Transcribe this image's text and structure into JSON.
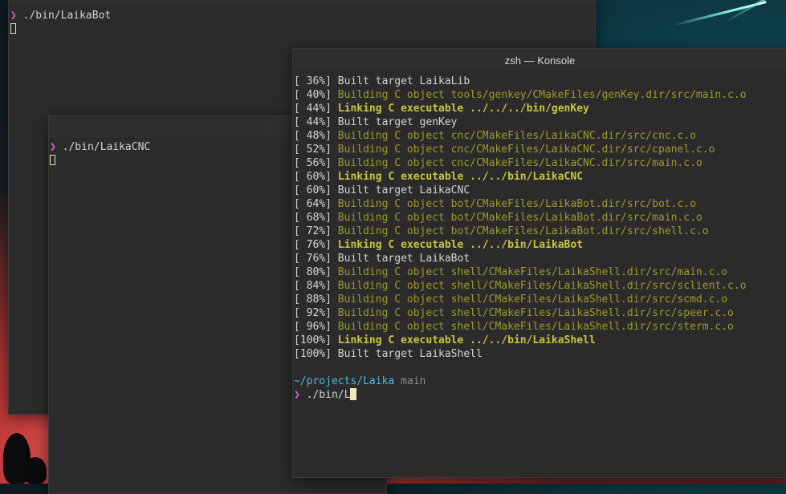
{
  "colors": {
    "terminal_bg": "#2b2b2b",
    "prompt_arrow": "#e05ec8",
    "building": "#9a9a2c",
    "linking": "#c7c73c",
    "cwd": "#4fb8e0",
    "branch": "#8a8a8a"
  },
  "windows": {
    "back": {
      "prompt_symbol": "❯",
      "command": " ./bin/LaikaBot"
    },
    "middle": {
      "prompt_symbol": "❯",
      "command": " ./bin/LaikaCNC"
    },
    "front": {
      "title": "zsh — Konsole",
      "build_output": [
        {
          "pct": "[ 36%] ",
          "text": "Built target LaikaLib",
          "kind": "built"
        },
        {
          "pct": "[ 40%] ",
          "text": "Building C object tools/genkey/CMakeFiles/genKey.dir/src/main.c.o",
          "kind": "building"
        },
        {
          "pct": "[ 44%] ",
          "text": "Linking C executable ../../../bin/genKey",
          "kind": "linking"
        },
        {
          "pct": "[ 44%] ",
          "text": "Built target genKey",
          "kind": "built"
        },
        {
          "pct": "[ 48%] ",
          "text": "Building C object cnc/CMakeFiles/LaikaCNC.dir/src/cnc.c.o",
          "kind": "building"
        },
        {
          "pct": "[ 52%] ",
          "text": "Building C object cnc/CMakeFiles/LaikaCNC.dir/src/cpanel.c.o",
          "kind": "building"
        },
        {
          "pct": "[ 56%] ",
          "text": "Building C object cnc/CMakeFiles/LaikaCNC.dir/src/main.c.o",
          "kind": "building"
        },
        {
          "pct": "[ 60%] ",
          "text": "Linking C executable ../../bin/LaikaCNC",
          "kind": "linking"
        },
        {
          "pct": "[ 60%] ",
          "text": "Built target LaikaCNC",
          "kind": "built"
        },
        {
          "pct": "[ 64%] ",
          "text": "Building C object bot/CMakeFiles/LaikaBot.dir/src/bot.c.o",
          "kind": "building"
        },
        {
          "pct": "[ 68%] ",
          "text": "Building C object bot/CMakeFiles/LaikaBot.dir/src/main.c.o",
          "kind": "building"
        },
        {
          "pct": "[ 72%] ",
          "text": "Building C object bot/CMakeFiles/LaikaBot.dir/src/shell.c.o",
          "kind": "building"
        },
        {
          "pct": "[ 76%] ",
          "text": "Linking C executable ../../bin/LaikaBot",
          "kind": "linking"
        },
        {
          "pct": "[ 76%] ",
          "text": "Built target LaikaBot",
          "kind": "built"
        },
        {
          "pct": "[ 80%] ",
          "text": "Building C object shell/CMakeFiles/LaikaShell.dir/src/main.c.o",
          "kind": "building"
        },
        {
          "pct": "[ 84%] ",
          "text": "Building C object shell/CMakeFiles/LaikaShell.dir/src/sclient.c.o",
          "kind": "building"
        },
        {
          "pct": "[ 88%] ",
          "text": "Building C object shell/CMakeFiles/LaikaShell.dir/src/scmd.c.o",
          "kind": "building"
        },
        {
          "pct": "[ 92%] ",
          "text": "Building C object shell/CMakeFiles/LaikaShell.dir/src/speer.c.o",
          "kind": "building"
        },
        {
          "pct": "[ 96%] ",
          "text": "Building C object shell/CMakeFiles/LaikaShell.dir/src/sterm.c.o",
          "kind": "building"
        },
        {
          "pct": "[100%] ",
          "text": "Linking C executable ../../bin/LaikaShell",
          "kind": "linking"
        },
        {
          "pct": "[100%] ",
          "text": "Built target LaikaShell",
          "kind": "built"
        }
      ],
      "cwd": "~/projects/Laika",
      "branch": " main",
      "prompt_symbol": "❯",
      "input": " ./bin/L"
    }
  }
}
